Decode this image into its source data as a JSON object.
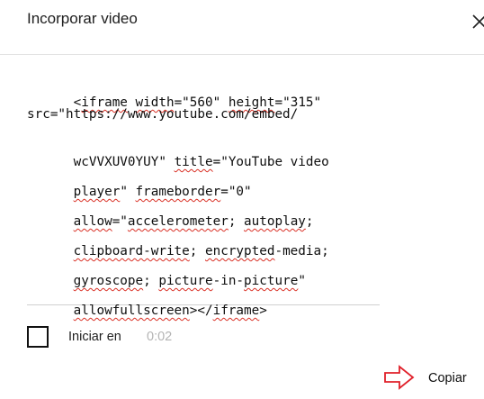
{
  "dialog": {
    "title": "Incorporar video",
    "close_icon": "close-icon"
  },
  "embed_code": {
    "lines": [
      "<iframe width=\"560\" height=\"315\"",
      "src=\"https://www.youtube.com/embed/",
      "wcVVXUV0YUY\" title=\"YouTube video",
      "player\" frameborder=\"0\"",
      "allow=\"accelerometer; autoplay;",
      "clipboard-write; encrypted-media;",
      "gyroscope; picture-in-picture\"",
      "allowfullscreen></iframe>"
    ]
  },
  "start_at": {
    "label": "Iniciar en",
    "time": "0:02",
    "checked": false
  },
  "copy": {
    "label": "Copiar",
    "arrow_icon": "arrow-right-outline-icon",
    "arrow_color": "#e0202a"
  }
}
